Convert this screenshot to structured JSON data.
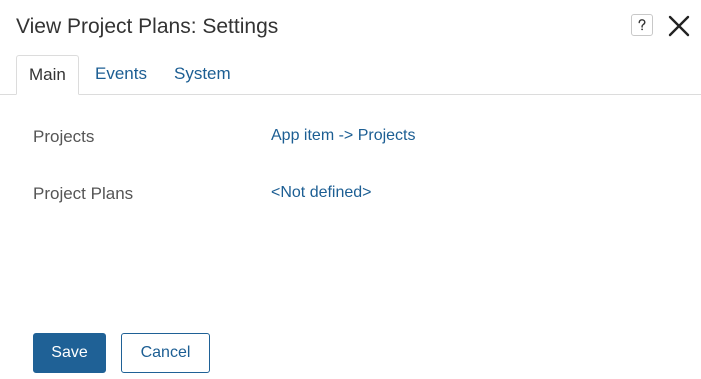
{
  "dialog": {
    "title": "View Project Plans: Settings",
    "help_icon": "help-question-icon",
    "close_icon": "close-x-icon"
  },
  "tabs": [
    {
      "label": "Main",
      "active": true
    },
    {
      "label": "Events",
      "active": false
    },
    {
      "label": "System",
      "active": false
    }
  ],
  "fields": [
    {
      "label": "Projects",
      "value": "App item -> Projects"
    },
    {
      "label": "Project Plans",
      "value": "<Not defined>"
    }
  ],
  "footer": {
    "save_label": "Save",
    "cancel_label": "Cancel"
  },
  "colors": {
    "accent": "#1f6196",
    "link": "#1c5e93",
    "text": "#333333",
    "border": "#dcdcdc"
  }
}
